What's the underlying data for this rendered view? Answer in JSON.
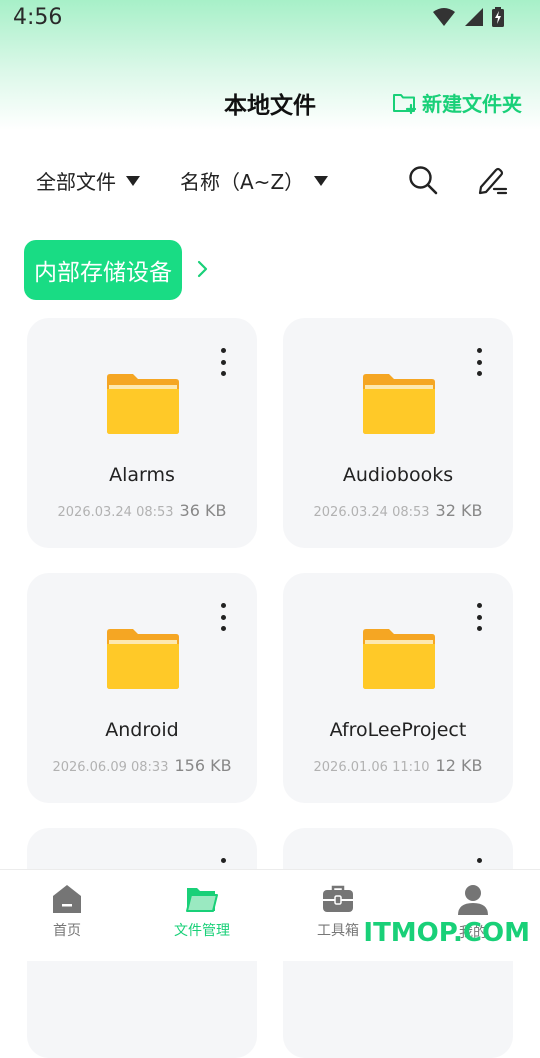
{
  "status_bar": {
    "time": "4:56"
  },
  "header": {
    "title": "本地文件",
    "new_folder_label": "新建文件夹"
  },
  "filters": {
    "type_filter": "全部文件",
    "sort_filter": "名称（A~Z）"
  },
  "storage": {
    "label": "内部存储设备"
  },
  "files": [
    {
      "name": "Alarms",
      "date": "2026.03.24 08:53",
      "size": "36 KB"
    },
    {
      "name": "Audiobooks",
      "date": "2026.03.24 08:53",
      "size": "32 KB"
    },
    {
      "name": "Android",
      "date": "2026.06.09 08:33",
      "size": "156 KB"
    },
    {
      "name": "AfroLeeProject",
      "date": "2026.01.06 11:10",
      "size": "12 KB"
    }
  ],
  "nav": {
    "items": [
      {
        "label": "首页",
        "icon": "home-icon"
      },
      {
        "label": "文件管理",
        "icon": "folder-open-icon",
        "active": true
      },
      {
        "label": "工具箱",
        "icon": "toolbox-icon"
      },
      {
        "label": "我的",
        "icon": "user-icon"
      }
    ]
  },
  "watermark": "ITMOP.COM",
  "colors": {
    "accent": "#19d078",
    "chip": "#19dc84",
    "folder": "#ffc928",
    "card_bg": "#f5f6f8"
  }
}
